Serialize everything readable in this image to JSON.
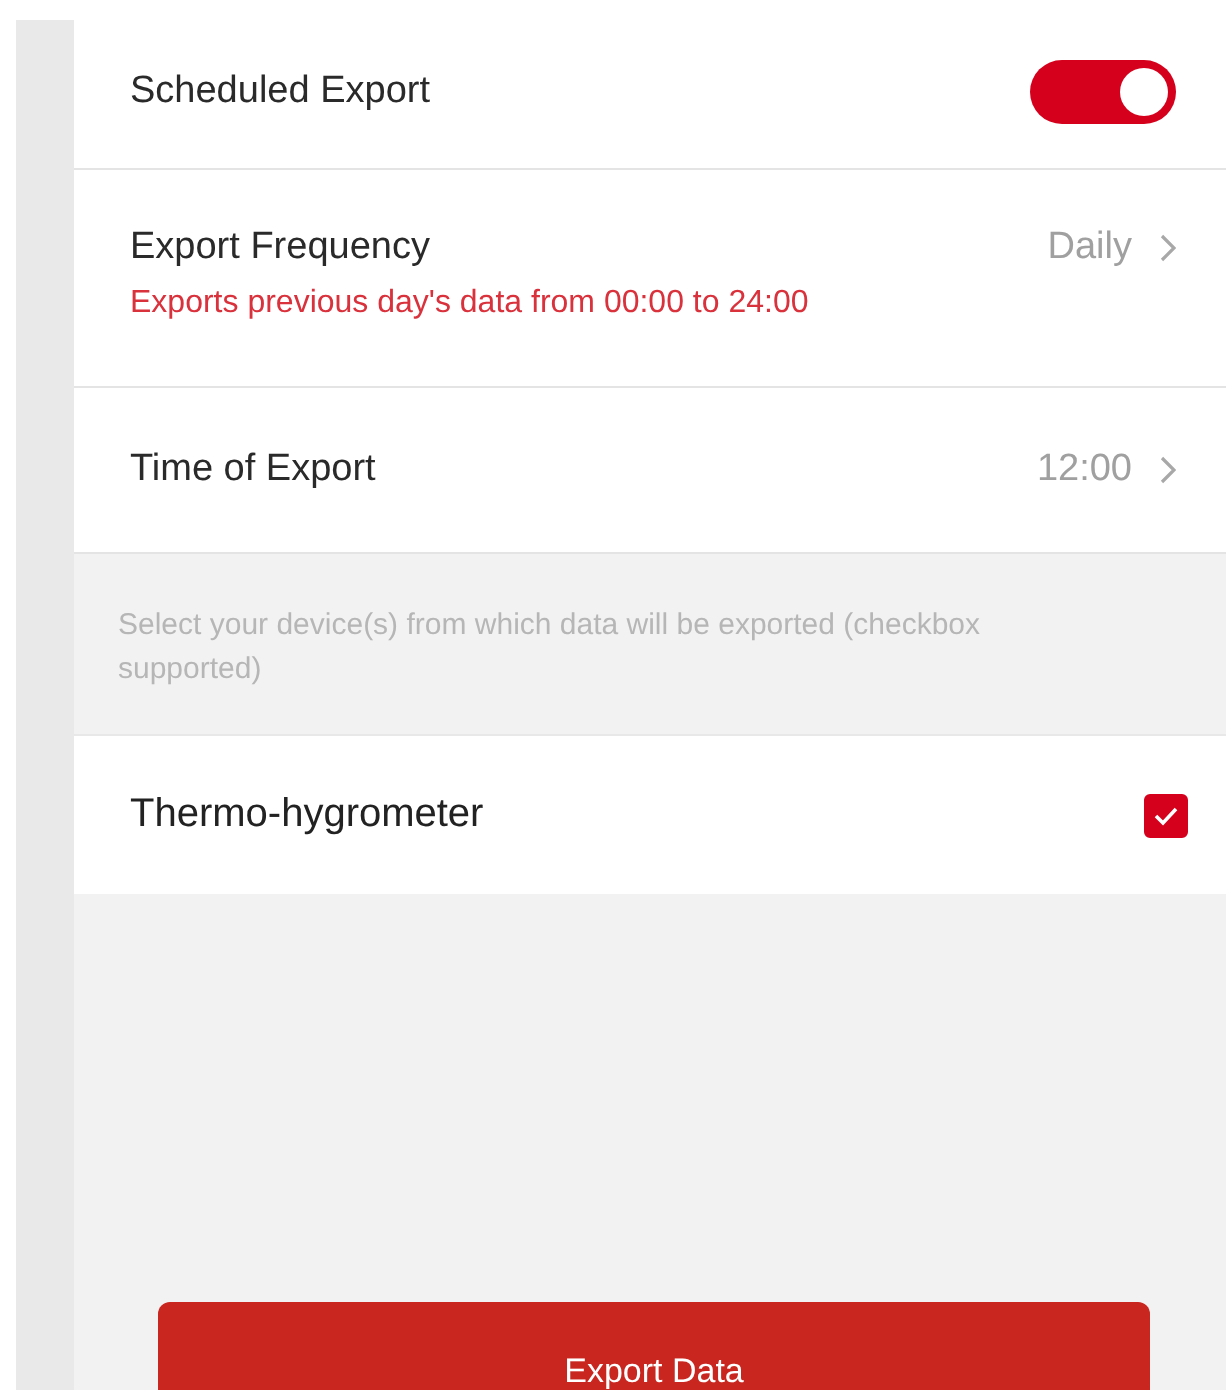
{
  "settings": [
    {
      "kind": "toggle",
      "label": "Scheduled Export",
      "on": true
    },
    {
      "kind": "value",
      "label": "Export Frequency",
      "value": "Daily",
      "note": "Exports previous day's data from 00:00 to 24:00"
    },
    {
      "kind": "value",
      "label": "Time of Export",
      "value": "12:00"
    }
  ],
  "device_hint": "Select your device(s) from which data will be exported (checkbox supported)",
  "devices": [
    {
      "name": "Thermo-hygrometer",
      "checked": true
    }
  ],
  "export_button": "Export Data"
}
